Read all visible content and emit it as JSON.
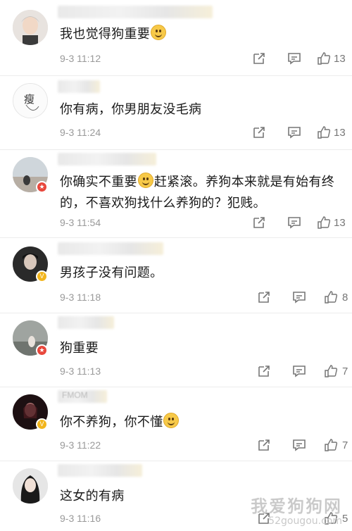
{
  "comments": [
    {
      "text": "我也觉得狗重要",
      "emoji": true,
      "time": "9-3 11:12",
      "likes": "13",
      "badge": null
    },
    {
      "text": "你有病，你男朋友没毛病",
      "emoji": false,
      "time": "9-3 11:24",
      "likes": "13",
      "badge": null,
      "avatar_char": "瘦"
    },
    {
      "text_a": "你确实不重要",
      "text_b": "赶紧滚。养狗本来就是有始有终的，不喜欢狗找什么养狗的？犯贱。",
      "time": "9-3 11:54",
      "likes": "13",
      "badge": "red"
    },
    {
      "text": "男孩子没有问题。",
      "time": "9-3 11:18",
      "likes": "8",
      "badge": "gold"
    },
    {
      "text": "狗重要",
      "time": "9-3 11:13",
      "likes": "7",
      "badge": "red"
    },
    {
      "text": "你不养狗，你不懂",
      "emoji": true,
      "time": "9-3 11:22",
      "likes": "7",
      "badge": "gold",
      "name_partial": "FMOM"
    },
    {
      "text": "这女的有病",
      "time": "9-3 11:16",
      "likes": "5",
      "badge": null
    }
  ],
  "watermark": {
    "title": "我爱狗狗网",
    "url": "52gougou.com"
  },
  "icons": {
    "share": "share-icon",
    "comment": "comment-icon",
    "like": "thumbs-up-icon"
  },
  "colors": {
    "time": "#999999",
    "badge_red": "#e8473c",
    "badge_gold": "#f2b51c"
  }
}
